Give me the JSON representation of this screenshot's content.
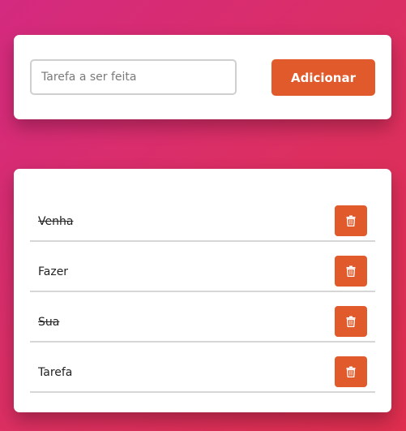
{
  "form": {
    "input_placeholder": "Tarefa a ser feita",
    "input_value": "",
    "add_label": "Adicionar"
  },
  "tasks": [
    {
      "text": "Venha",
      "completed": true
    },
    {
      "text": "Fazer",
      "completed": false
    },
    {
      "text": "Sua",
      "completed": true
    },
    {
      "text": "Tarefa",
      "completed": false
    }
  ],
  "icons": {
    "delete": "trash-icon"
  },
  "colors": {
    "accent": "#e05a2b",
    "background_start": "#d42a80",
    "background_end": "#df2e4e",
    "card": "#ffffff",
    "divider": "#d6d6d6"
  }
}
